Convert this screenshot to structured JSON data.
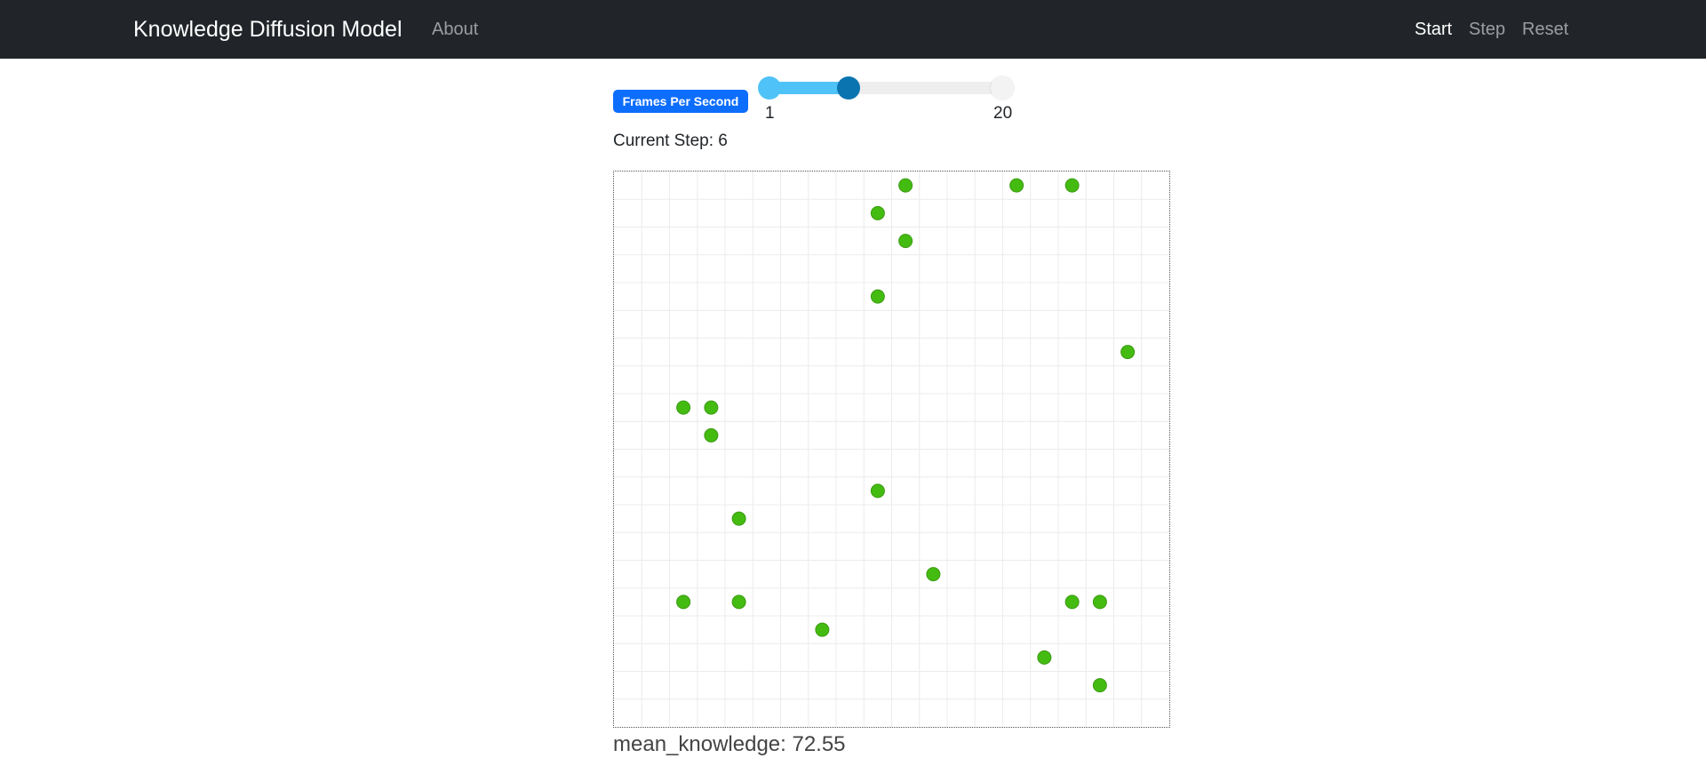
{
  "navbar": {
    "brand": "Knowledge Diffusion Model",
    "about": "About",
    "start": "Start",
    "step": "Step",
    "reset": "Reset"
  },
  "controls": {
    "fps_label": "Frames Per Second",
    "slider_min": "1",
    "slider_max": "20",
    "slider_value_fraction": 0.34,
    "current_step_prefix": "Current Step: ",
    "current_step": "6"
  },
  "grid": {
    "cols": 20,
    "rows": 20,
    "agent_color": "#44bb11",
    "agent_stroke": "#3a9a12",
    "grid_line_color": "#ececec",
    "agents": [
      {
        "col": 10,
        "row": 0
      },
      {
        "col": 14,
        "row": 0
      },
      {
        "col": 16,
        "row": 0
      },
      {
        "col": 9,
        "row": 1
      },
      {
        "col": 10,
        "row": 2
      },
      {
        "col": 9,
        "row": 4
      },
      {
        "col": 18,
        "row": 6
      },
      {
        "col": 2,
        "row": 8
      },
      {
        "col": 3,
        "row": 8
      },
      {
        "col": 3,
        "row": 9
      },
      {
        "col": 9,
        "row": 11
      },
      {
        "col": 4,
        "row": 12
      },
      {
        "col": 11,
        "row": 14
      },
      {
        "col": 2,
        "row": 15
      },
      {
        "col": 4,
        "row": 15
      },
      {
        "col": 16,
        "row": 15
      },
      {
        "col": 17,
        "row": 15
      },
      {
        "col": 7,
        "row": 16
      },
      {
        "col": 15,
        "row": 17
      },
      {
        "col": 17,
        "row": 18
      }
    ]
  },
  "stats": {
    "mean_label": "mean_knowledge: ",
    "mean_value": "72.55"
  }
}
